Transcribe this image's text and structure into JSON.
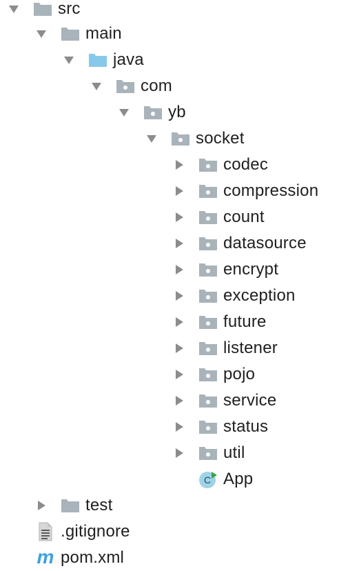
{
  "project_tree": {
    "items": [
      {
        "label": "src",
        "expanded": true,
        "icon": "folder-icon"
      },
      {
        "label": "main",
        "expanded": true,
        "icon": "folder-icon"
      },
      {
        "label": "java",
        "expanded": true,
        "icon": "source-folder-icon"
      },
      {
        "label": "com",
        "expanded": true,
        "icon": "package-icon"
      },
      {
        "label": "yb",
        "expanded": true,
        "icon": "package-icon"
      },
      {
        "label": "socket",
        "expanded": true,
        "icon": "package-icon"
      },
      {
        "label": "codec",
        "expanded": false,
        "icon": "package-icon"
      },
      {
        "label": "compression",
        "expanded": false,
        "icon": "package-icon"
      },
      {
        "label": "count",
        "expanded": false,
        "icon": "package-icon"
      },
      {
        "label": "datasource",
        "expanded": false,
        "icon": "package-icon"
      },
      {
        "label": "encrypt",
        "expanded": false,
        "icon": "package-icon"
      },
      {
        "label": "exception",
        "expanded": false,
        "icon": "package-icon"
      },
      {
        "label": "future",
        "expanded": false,
        "icon": "package-icon"
      },
      {
        "label": "listener",
        "expanded": false,
        "icon": "package-icon"
      },
      {
        "label": "pojo",
        "expanded": false,
        "icon": "package-icon"
      },
      {
        "label": "service",
        "expanded": false,
        "icon": "package-icon"
      },
      {
        "label": "status",
        "expanded": false,
        "icon": "package-icon"
      },
      {
        "label": "util",
        "expanded": false,
        "icon": "package-icon"
      },
      {
        "label": "App",
        "icon": "java-class-icon"
      },
      {
        "label": "test",
        "expanded": false,
        "icon": "folder-icon"
      },
      {
        "label": ".gitignore",
        "icon": "text-file-icon"
      },
      {
        "label": "pom.xml",
        "icon": "maven-icon"
      }
    ]
  },
  "colors": {
    "folder": "#a9b3ba",
    "source_folder": "#87c9ea",
    "arrow": "#8c8c8c",
    "class_icon_bg": "#9ed3e8",
    "class_icon_accent": "#3aa345",
    "maven": "#3fa1dc",
    "text": "#1f1f1f"
  }
}
